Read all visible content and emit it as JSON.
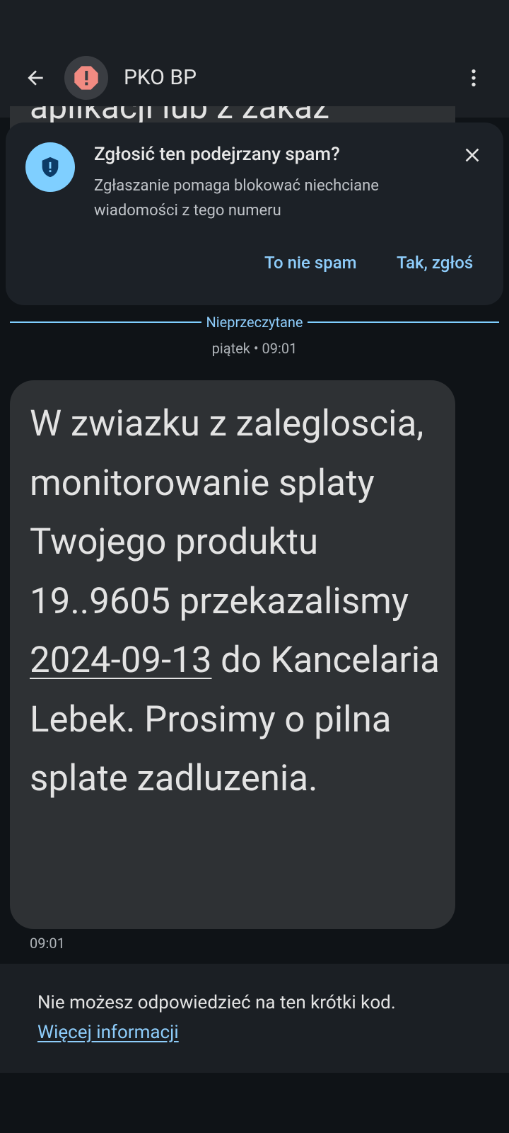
{
  "header": {
    "title": "PKO BP",
    "back_icon": "arrow-left-icon",
    "avatar_icon": "alert-octagon-icon",
    "more_icon": "more-vertical-icon"
  },
  "previous_message_fragment": "aplikacji lub z zakaz",
  "spam_card": {
    "title": "Zgłosić ten podejrzany spam?",
    "text": "Zgłaszanie pomaga blokować niechciane wiadomości z tego numeru",
    "not_spam_button": "To nie spam",
    "report_button": "Tak, zgłoś",
    "accent": "#7fcfff"
  },
  "divider": {
    "label": "Nieprzeczytane"
  },
  "date_label": "piątek • 09:01",
  "message": {
    "text_before": "W zwiazku z zalegloscia, monitorowanie splaty Twojego produktu 19..9605 przekazalismy ",
    "date_link": "2024-09-13",
    "text_after": " do Kancelaria Lebek. Prosimy o pilna splate zadluzenia.",
    "time": "09:01"
  },
  "footer": {
    "text": "Nie możesz odpowiedzieć na ten krótki kod.",
    "link": "Więcej informacji"
  },
  "colors": {
    "background": "#0f1317",
    "surface": "#1b1f24",
    "bubble": "#2e3134",
    "link": "#8ecdfb",
    "warning": "#f28b82"
  }
}
